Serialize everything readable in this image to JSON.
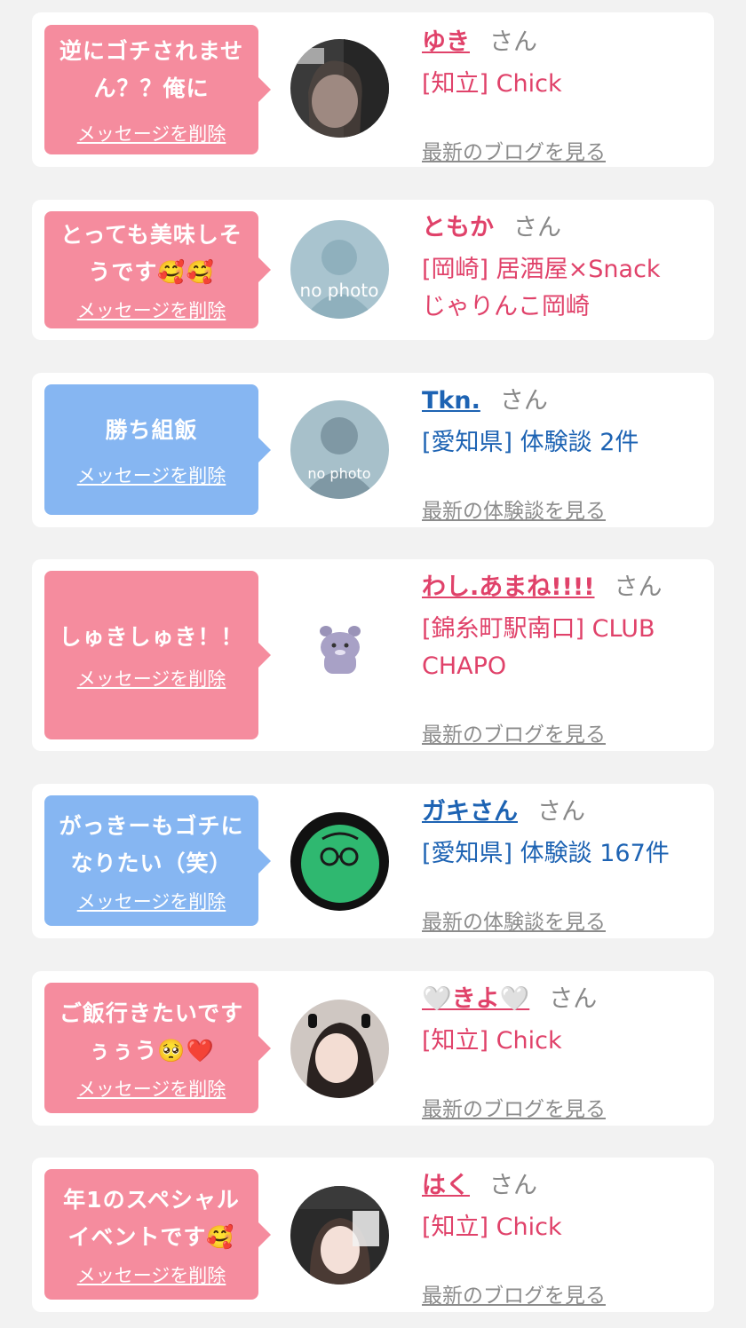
{
  "common": {
    "delete_label": "メッセージを削除",
    "honorific": "さん"
  },
  "items": [
    {
      "message_l1": "逆にゴチされませ",
      "message_l2": "ん？？俺に",
      "name": "ゆき",
      "shop_l1": "[知立] Chick",
      "shop_l2": "",
      "link": "最新のブログを見る",
      "theme": "pink"
    },
    {
      "message_l1": "とっても美味しそ",
      "message_l2": "うです🥰🥰",
      "name": "ともか",
      "shop_l1": "[岡崎] 居酒屋×Snack",
      "shop_l2": "じゃりんこ岡崎",
      "link": "",
      "avatar_text": "no photo",
      "theme": "pink"
    },
    {
      "message_l1": "勝ち組飯",
      "message_l2": "",
      "name": "Tkn.",
      "shop_l1": "[愛知県] 体験談 2件",
      "shop_l2": "",
      "link": "最新の体験談を見る",
      "avatar_text": "no photo",
      "theme": "blue"
    },
    {
      "message_l1": "しゅきしゅき！！",
      "message_l2": "",
      "name": "わし.あまね!!!!",
      "shop_l1": "[錦糸町駅南口] CLUB",
      "shop_l2": "CHAPO",
      "link": "最新のブログを見る",
      "theme": "pink"
    },
    {
      "message_l1": "がっきーもゴチに",
      "message_l2": "なりたい（笑）",
      "name": "ガキさん",
      "shop_l1": "[愛知県] 体験談 167件",
      "shop_l2": "",
      "link": "最新の体験談を見る",
      "theme": "blue"
    },
    {
      "message_l1": "ご飯行きたいです",
      "message_l2": "ぅぅう🥺❤️",
      "name": "🤍きよ🤍",
      "shop_l1": "[知立] Chick",
      "shop_l2": "",
      "link": "最新のブログを見る",
      "theme": "pink"
    },
    {
      "message_l1": "年1のスペシャル",
      "message_l2": "イベントです🥰",
      "name": "はく",
      "shop_l1": "[知立] Chick",
      "shop_l2": "",
      "link": "最新のブログを見る",
      "theme": "pink"
    }
  ],
  "colors": {
    "pink_bubble": "#f58c9e",
    "blue_bubble": "#86b6f2",
    "pink_text": "#e0426a",
    "blue_text": "#1d63b3",
    "muted": "#8c8c8c"
  }
}
